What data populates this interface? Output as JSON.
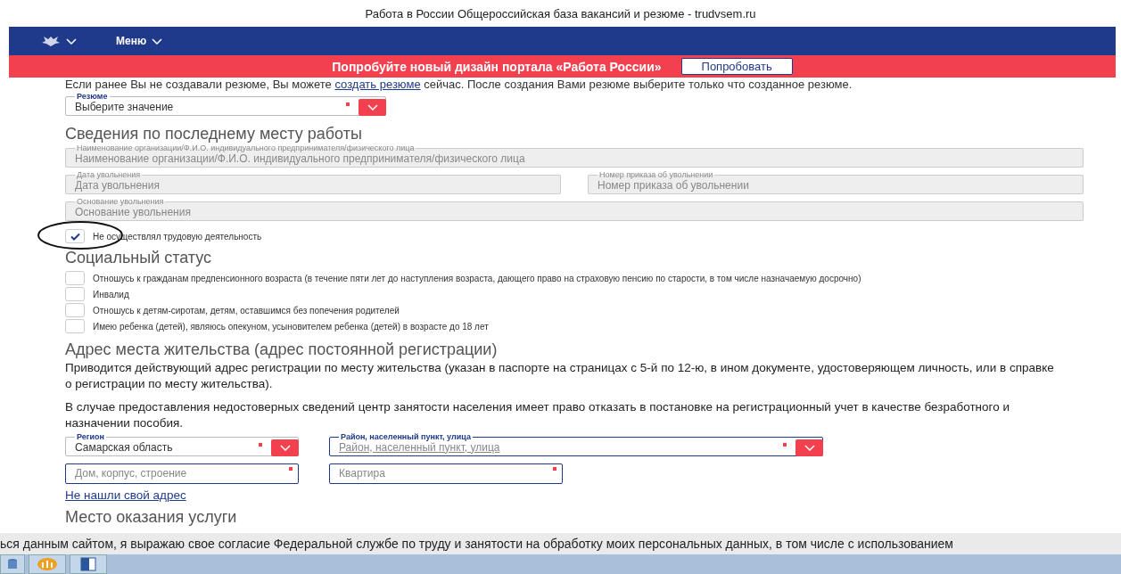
{
  "browser": {
    "title": "Работа в России Общероссийская база вакансий и резюме - trudvsem.ru"
  },
  "navbar": {
    "menu_label": "Меню"
  },
  "banner": {
    "text": "Попробуйте новый дизайн портала «Работа России»",
    "button": "Попробовать"
  },
  "intro": {
    "before": "Если ранее Вы не создавали резюме, Вы можете ",
    "link": "создать резюме",
    "after": " сейчас. После создания Вами резюме выберите только что созданное резюме."
  },
  "resume_field": {
    "label": "Резюме",
    "value": "Выберите значение",
    "required": true
  },
  "last_job": {
    "heading": "Сведения по последнему месту работы",
    "rows": [
      [
        {
          "label": "Наименование организации/Ф.И.О. индивидуального предпринимателя/физического лица",
          "placeholder": "Наименование организации/Ф.И.О. индивидуального предпринимателя/физического лица",
          "disabled": true
        }
      ],
      [
        {
          "label": "Дата увольнения",
          "placeholder": "Дата увольнения",
          "disabled": true
        },
        {
          "label": "Номер приказа об увольнении",
          "placeholder": "Номер приказа об увольнении",
          "disabled": true
        }
      ],
      [
        {
          "label": "Основание увольнения",
          "placeholder": "Основание увольнения",
          "disabled": true
        }
      ]
    ],
    "no_work": {
      "label": "Не осуществлял трудовую деятельность",
      "checked": true
    }
  },
  "social_status": {
    "heading": "Социальный статус",
    "options": [
      {
        "label": "Отношусь к гражданам предпенсионного возраста (в течение пяти лет до наступления возраста, дающего право на страховую пенсию по старости, в том числе назначаемую досрочно)",
        "checked": false
      },
      {
        "label": "Инвалид",
        "checked": false
      },
      {
        "label": "Отношусь к детям-сиротам, детям, оставшимся без попечения родителей",
        "checked": false
      },
      {
        "label": "Имею ребенка (детей), являюсь опекуном, усыновителем ребенка (детей) в возрасте до 18 лет",
        "checked": false
      }
    ]
  },
  "address": {
    "heading": "Адрес места жительства (адрес постоянной регистрации)",
    "notes": [
      "Приводится действующий адрес регистрации по месту жительства (указан в паспорте на страницах с 5-й по 12-ю, в ином документе, удостоверяющем личность, или в справке о регистрации по месту жительства).",
      "В случае предоставления недостоверных сведений центр занятости населения имеет право отказать в постановке на регистрационный учет в качестве безработного и назначении пособия."
    ],
    "region": {
      "label": "Регион",
      "value": "Самарская область",
      "required": true
    },
    "locality": {
      "label": "Район, населенный пункт, улица",
      "placeholder": "Район, населенный пункт, улица",
      "required": true
    },
    "house": {
      "placeholder": "Дом, корпус, строение",
      "required": true
    },
    "apartment": {
      "placeholder": "Квартира",
      "required": true
    },
    "link": "Не нашли свой адрес"
  },
  "service_place": {
    "heading": "Место оказания услуги"
  },
  "cookie_notice": {
    "text": "ься данным сайтом, я выражаю свое согласие Федеральной службе по труду и занятости на обработку моих персональных данных, в том числе с использованием"
  }
}
